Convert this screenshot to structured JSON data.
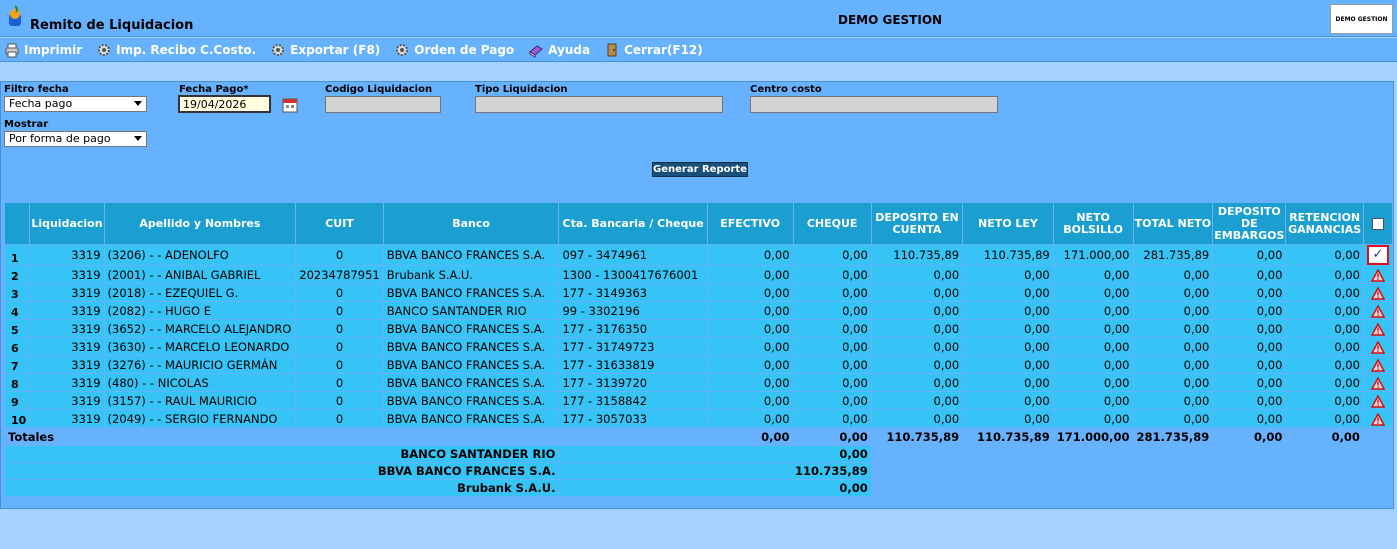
{
  "header": {
    "title": "Remito de Liquidacion",
    "company": "DEMO GESTION",
    "brand": "DEMO GESTION"
  },
  "toolbar": {
    "print": "Imprimir",
    "receipt": "Imp. Recibo C.Costo.",
    "export": "Exportar (F8)",
    "payment_order": "Orden de Pago",
    "help": "Ayuda",
    "close": "Cerrar(F12)"
  },
  "filters": {
    "filter_date_label": "Filtro fecha",
    "filter_date_value": "Fecha pago",
    "pay_date_label": "Fecha Pago*",
    "pay_date_value": "19/04/2026",
    "code_label": "Codigo Liquidacion",
    "type_label": "Tipo Liquidacion",
    "cost_center_label": "Centro costo",
    "show_label": "Mostrar",
    "show_value": "Por forma de pago",
    "generate_button": "Generar Reporte"
  },
  "table": {
    "headers": [
      "Liquidacion",
      "Apellido y Nombres",
      "CUIT",
      "Banco",
      "Cta. Bancaria / Cheque",
      "EFECTIVO",
      "CHEQUE",
      "DEPOSITO EN CUENTA",
      "NETO LEY",
      "NETO BOLSILLO",
      "TOTAL NETO",
      "DEPOSITO DE EMBARGOS",
      "RETENCION GANANCIAS"
    ],
    "rows": [
      {
        "n": "1",
        "liq": "3319",
        "name": "(3206) - - ADENOLFO",
        "cuit": "0",
        "bank": "BBVA BANCO FRANCES S.A.",
        "acct": "097 - 3474961",
        "efectivo": "0,00",
        "cheque": "0,00",
        "deposito": "110.735,89",
        "neto_ley": "110.735,89",
        "neto_bolsillo": "171.000,00",
        "total_neto": "281.735,89",
        "embargos": "0,00",
        "retencion": "0,00",
        "status": "ok"
      },
      {
        "n": "2",
        "liq": "3319",
        "name": "(2001) - - ANIBAL GABRIEL",
        "cuit": "20234787951",
        "bank": "Brubank S.A.U.",
        "acct": "1300 - 1300417676001",
        "efectivo": "0,00",
        "cheque": "0,00",
        "deposito": "0,00",
        "neto_ley": "0,00",
        "neto_bolsillo": "0,00",
        "total_neto": "0,00",
        "embargos": "0,00",
        "retencion": "0,00",
        "status": "warn"
      },
      {
        "n": "3",
        "liq": "3319",
        "name": "(2018) - - EZEQUIEL G.",
        "cuit": "0",
        "bank": "BBVA BANCO FRANCES S.A.",
        "acct": "177 - 3149363",
        "efectivo": "0,00",
        "cheque": "0,00",
        "deposito": "0,00",
        "neto_ley": "0,00",
        "neto_bolsillo": "0,00",
        "total_neto": "0,00",
        "embargos": "0,00",
        "retencion": "0,00",
        "status": "warn"
      },
      {
        "n": "4",
        "liq": "3319",
        "name": "(2082) - - HUGO E",
        "cuit": "0",
        "bank": "BANCO SANTANDER RIO",
        "acct": "99 - 3302196",
        "efectivo": "0,00",
        "cheque": "0,00",
        "deposito": "0,00",
        "neto_ley": "0,00",
        "neto_bolsillo": "0,00",
        "total_neto": "0,00",
        "embargos": "0,00",
        "retencion": "0,00",
        "status": "warn"
      },
      {
        "n": "5",
        "liq": "3319",
        "name": "(3652) - - MARCELO ALEJANDRO",
        "cuit": "0",
        "bank": "BBVA BANCO FRANCES S.A.",
        "acct": "177 - 3176350",
        "efectivo": "0,00",
        "cheque": "0,00",
        "deposito": "0,00",
        "neto_ley": "0,00",
        "neto_bolsillo": "0,00",
        "total_neto": "0,00",
        "embargos": "0,00",
        "retencion": "0,00",
        "status": "warn"
      },
      {
        "n": "6",
        "liq": "3319",
        "name": "(3630) - - MARCELO LEONARDO",
        "cuit": "0",
        "bank": "BBVA BANCO FRANCES S.A.",
        "acct": "177 - 31749723",
        "efectivo": "0,00",
        "cheque": "0,00",
        "deposito": "0,00",
        "neto_ley": "0,00",
        "neto_bolsillo": "0,00",
        "total_neto": "0,00",
        "embargos": "0,00",
        "retencion": "0,00",
        "status": "warn"
      },
      {
        "n": "7",
        "liq": "3319",
        "name": "(3276) - - MAURICIO GERMÁN",
        "cuit": "0",
        "bank": "BBVA BANCO FRANCES S.A.",
        "acct": "177 - 31633819",
        "efectivo": "0,00",
        "cheque": "0,00",
        "deposito": "0,00",
        "neto_ley": "0,00",
        "neto_bolsillo": "0,00",
        "total_neto": "0,00",
        "embargos": "0,00",
        "retencion": "0,00",
        "status": "warn"
      },
      {
        "n": "8",
        "liq": "3319",
        "name": "(480) - - NICOLAS",
        "cuit": "0",
        "bank": "BBVA BANCO FRANCES S.A.",
        "acct": "177 - 3139720",
        "efectivo": "0,00",
        "cheque": "0,00",
        "deposito": "0,00",
        "neto_ley": "0,00",
        "neto_bolsillo": "0,00",
        "total_neto": "0,00",
        "embargos": "0,00",
        "retencion": "0,00",
        "status": "warn"
      },
      {
        "n": "9",
        "liq": "3319",
        "name": "(3157) - - RAUL MAURICIO",
        "cuit": "0",
        "bank": "BBVA BANCO FRANCES S.A.",
        "acct": "177 - 3158842",
        "efectivo": "0,00",
        "cheque": "0,00",
        "deposito": "0,00",
        "neto_ley": "0,00",
        "neto_bolsillo": "0,00",
        "total_neto": "0,00",
        "embargos": "0,00",
        "retencion": "0,00",
        "status": "warn"
      },
      {
        "n": "10",
        "liq": "3319",
        "name": "(2049) - - SERGIO FERNANDO",
        "cuit": "0",
        "bank": "BBVA BANCO FRANCES S.A.",
        "acct": "177 - 3057033",
        "efectivo": "0,00",
        "cheque": "0,00",
        "deposito": "0,00",
        "neto_ley": "0,00",
        "neto_bolsillo": "0,00",
        "total_neto": "0,00",
        "embargos": "0,00",
        "retencion": "0,00",
        "status": "warn"
      }
    ],
    "totals": {
      "label": "Totales",
      "efectivo": "0,00",
      "cheque": "0,00",
      "deposito": "110.735,89",
      "neto_ley": "110.735,89",
      "neto_bolsillo": "171.000,00",
      "total_neto": "281.735,89",
      "embargos": "0,00",
      "retencion": "0,00"
    },
    "bank_totals": [
      {
        "bank": "BANCO SANTANDER RIO",
        "amount": "0,00"
      },
      {
        "bank": "BBVA BANCO FRANCES S.A.",
        "amount": "110.735,89"
      },
      {
        "bank": "Brubank S.A.U.",
        "amount": "0,00"
      }
    ],
    "ok_mark": "✓"
  },
  "colors": {
    "panel": "#67b2ff",
    "header_cell": "#1a9fd0",
    "data_cell": "#35c4f5",
    "highlight": "#e0101a"
  }
}
